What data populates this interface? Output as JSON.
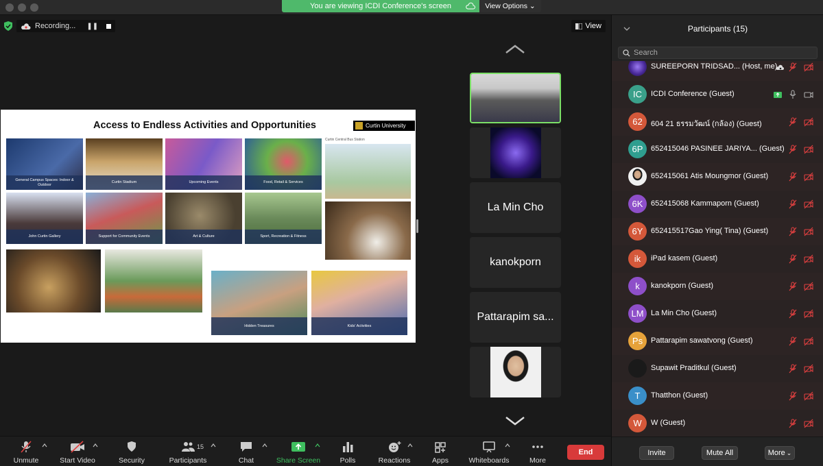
{
  "banner": {
    "text": "You are viewing ICDI Conference's screen",
    "view_options": "View Options"
  },
  "recording": {
    "label": "Recording..."
  },
  "view_button": "View",
  "slide": {
    "title": "Access to Endless Activities and Opportunities",
    "brand": "Curtin University",
    "bus_label": "Curtin Central Bus Station",
    "tiles": [
      "General Campus Spaces: Indoor & Outdoor",
      "Curtin Stadium",
      "Upcoming Events",
      "Food, Retail & Services",
      "John Curtin Gallery",
      "Support for Community Events",
      "Art & Culture",
      "Sport, Recreation & Fitness",
      "Hidden Treasures",
      "Kids' Activities"
    ]
  },
  "gallery": {
    "tiles": [
      "La Min Cho",
      "kanokporn",
      "Pattarapim sa..."
    ]
  },
  "participants": {
    "title": "Participants (15)",
    "search_placeholder": "Search",
    "list": [
      {
        "initials": "",
        "name": "SUREEPORN TRIDSAD... (Host, me)",
        "color": "#6a3fb8"
      },
      {
        "initials": "IC",
        "name": "ICDI Conference (Guest)",
        "color": "#3aa08a"
      },
      {
        "initials": "62",
        "name": "604 21 ธรรมวัฒน์ (กล้อง) (Guest)",
        "color": "#d4583a"
      },
      {
        "initials": "6P",
        "name": "652415046 PASINEE JARIYA...  (Guest)",
        "color": "#2f9e8f"
      },
      {
        "initials": "",
        "name": "652415061 Atis Moungmor (Guest)",
        "color": "#e8e8e8"
      },
      {
        "initials": "6K",
        "name": "652415068 Kammaporn (Guest)",
        "color": "#8e4fc9"
      },
      {
        "initials": "6Y",
        "name": "652415517Gao Ying( Tina) (Guest)",
        "color": "#d4583a"
      },
      {
        "initials": "ik",
        "name": "iPad kasem (Guest)",
        "color": "#d4583a"
      },
      {
        "initials": "k",
        "name": "kanokporn (Guest)",
        "color": "#8e4fc9"
      },
      {
        "initials": "LM",
        "name": "La Min Cho (Guest)",
        "color": "#8e4fc9"
      },
      {
        "initials": "Ps",
        "name": "Pattarapim sawatvong (Guest)",
        "color": "#e6a23a"
      },
      {
        "initials": "",
        "name": "Supawit Praditkul (Guest)",
        "color": "#1a1a1a"
      },
      {
        "initials": "T",
        "name": "Thatthon (Guest)",
        "color": "#3a8fc9"
      },
      {
        "initials": "W",
        "name": "W (Guest)",
        "color": "#d4583a"
      }
    ],
    "invite": "Invite",
    "mute_all": "Mute All",
    "more": "More"
  },
  "toolbar": {
    "unmute": "Unmute",
    "start_video": "Start Video",
    "security": "Security",
    "participants": "Participants",
    "participants_count": "15",
    "chat": "Chat",
    "share_screen": "Share Screen",
    "polls": "Polls",
    "reactions": "Reactions",
    "apps": "Apps",
    "whiteboards": "Whiteboards",
    "more": "More",
    "end": "End"
  },
  "colors": {
    "banner_green": "#4fb96b",
    "active_tile_border": "#7ce067",
    "end_red": "#d83a3a",
    "share_green": "#3fbf5f"
  }
}
